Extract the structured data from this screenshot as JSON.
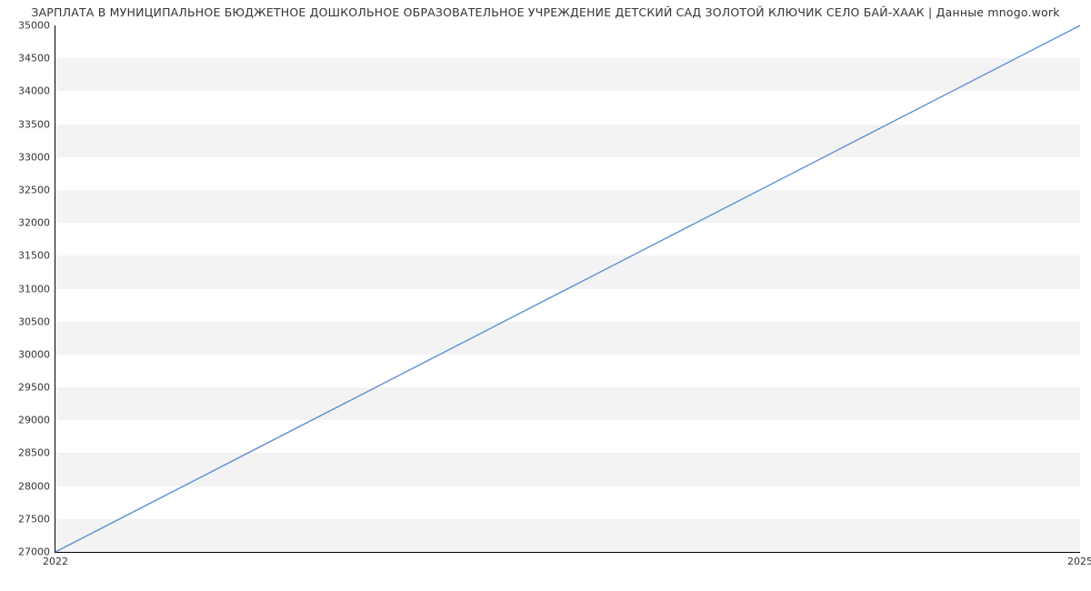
{
  "chart_data": {
    "type": "line",
    "title": "ЗАРПЛАТА В МУНИЦИПАЛЬНОЕ БЮДЖЕТНОЕ ДОШКОЛЬНОЕ ОБРАЗОВАТЕЛЬНОЕ УЧРЕЖДЕНИЕ ДЕТСКИЙ САД ЗОЛОТОЙ КЛЮЧИК СЕЛО БАЙ-ХААК | Данные mnogo.work",
    "xlabel": "",
    "ylabel": "",
    "x": [
      2022,
      2025
    ],
    "values": [
      27000,
      35000
    ],
    "ylim": [
      27000,
      35000
    ],
    "xlim": [
      2022,
      2025
    ],
    "y_ticks": [
      27000,
      27500,
      28000,
      28500,
      29000,
      29500,
      30000,
      30500,
      31000,
      31500,
      32000,
      32500,
      33000,
      33500,
      34000,
      34500,
      35000
    ],
    "x_ticks": [
      2022,
      2025
    ],
    "colors": {
      "line": "#5b8ed6",
      "band": "#f3f3f3"
    }
  }
}
